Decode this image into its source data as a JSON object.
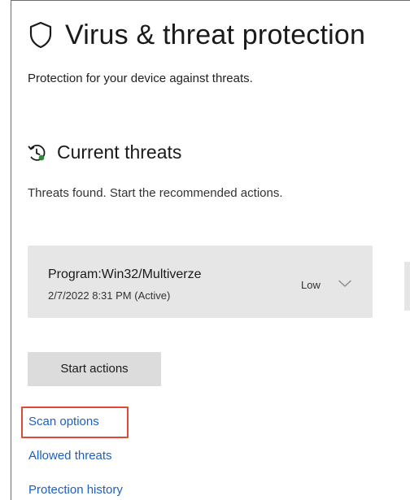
{
  "header": {
    "icon": "shield-icon",
    "title": "Virus & threat protection",
    "subtitle": "Protection for your device against threats."
  },
  "current_threats": {
    "icon": "threat-clock-icon",
    "title": "Current threats",
    "description": "Threats found. Start the recommended actions.",
    "threats": [
      {
        "name": "Program:Win32/Multiverze",
        "date": "2/7/2022 8:31 PM (Active)",
        "level": "Low",
        "expand_icon": "chevron-down-icon"
      }
    ],
    "start_button": "Start actions"
  },
  "links": {
    "scan_options": "Scan options",
    "allowed_threats": "Allowed threats",
    "protection_history": "Protection history"
  },
  "colors": {
    "link": "#1f5fbf",
    "highlight": "#e0483c",
    "card_bg": "#e6e6e6",
    "button_bg": "#dcdcdc"
  }
}
